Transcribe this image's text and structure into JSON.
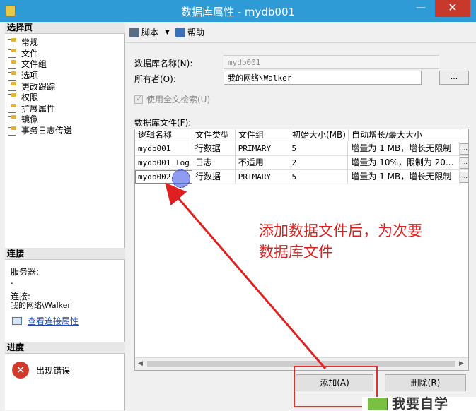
{
  "window": {
    "title": "数据库属性 - mydb001",
    "min_glyph": "—",
    "close_glyph": "✕"
  },
  "left": {
    "select_page_header": "选择页",
    "pages": [
      "常规",
      "文件",
      "文件组",
      "选项",
      "更改跟踪",
      "权限",
      "扩展属性",
      "镜像",
      "事务日志传送"
    ],
    "connection_header": "连接",
    "server_label": "服务器:",
    "server_value": ".",
    "connection_label": "连接:",
    "connection_value": "我的网络\\Walker",
    "view_connection_link": "查看连接属性",
    "progress_header": "进度",
    "progress_status": "出现错误",
    "error_glyph": "✕"
  },
  "toolbar": {
    "script_label": "脚本",
    "help_label": "帮助"
  },
  "form": {
    "db_name_label": "数据库名称(N):",
    "db_name_value": "mydb001",
    "owner_label": "所有者(O):",
    "owner_value": "我的网络\\Walker",
    "browse_label": "...",
    "fulltext_label": "使用全文检索(U)",
    "db_files_label": "数据库文件(F):"
  },
  "grid": {
    "headers": [
      "逻辑名称",
      "文件类型",
      "文件组",
      "初始大小(MB)",
      "自动增长/最大大小"
    ],
    "rows": [
      {
        "name": "mydb001",
        "type": "行数据",
        "group": "PRIMARY",
        "size": "5",
        "growth": "增量为 1 MB，增长无限制"
      },
      {
        "name": "mydb001_log",
        "type": "日志",
        "group": "不适用",
        "size": "2",
        "growth": "增量为 10%，限制为 20..."
      },
      {
        "name": "mydb002",
        "type": "行数据",
        "group": "PRIMARY",
        "size": "5",
        "growth": "增量为 1 MB，增长无限制"
      }
    ]
  },
  "buttons": {
    "add": "添加(A)",
    "remove": "删除(R)"
  },
  "annotation": {
    "line1": "添加数据文件后，为次要",
    "line2": "数据库文件",
    "color": "#e02020"
  },
  "watermark": {
    "text": "我要自学"
  }
}
